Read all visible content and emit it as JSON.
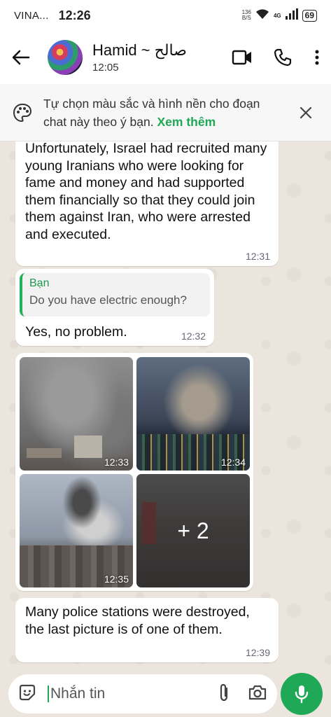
{
  "statusbar": {
    "carrier": "VINA...",
    "time": "12:26",
    "netspeed_value": "136",
    "netspeed_unit": "B/S",
    "network": "4G",
    "battery": "69"
  },
  "header": {
    "contact_name": "Hamid ~ صالح",
    "last_seen": "12:05"
  },
  "banner": {
    "text": "Tự chọn màu sắc và hình nền cho đoạn chat này theo ý bạn.",
    "link": "Xem thêm"
  },
  "messages": [
    {
      "text": "Unfortunately, Israel had recruited many young Iranians who were looking for fame and money and had supported them financially so that they could join them against Iran, who were arrested and executed.",
      "time": "12:31"
    },
    {
      "quote_name": "Bạn",
      "quote_text": "Do you have electric enough?",
      "text": "Yes, no problem.",
      "time": "12:32"
    },
    {
      "photos": [
        {
          "time": "12:33"
        },
        {
          "time": "12:34"
        },
        {
          "time": "12:35"
        },
        {
          "more": "+ 2"
        }
      ]
    },
    {
      "text": "Many police stations were destroyed, the last picture is of one of them.",
      "time": "12:39"
    }
  ],
  "input": {
    "placeholder": "Nhắn tin"
  },
  "colors": {
    "accent": "#1fa855",
    "chat_background": "#ece5dd",
    "bubble": "#ffffff"
  }
}
